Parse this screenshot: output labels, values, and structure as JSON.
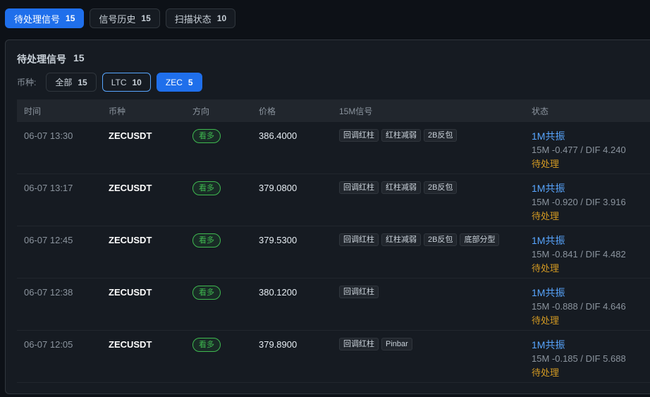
{
  "tabs": [
    {
      "label": "待处理信号",
      "count": "15"
    },
    {
      "label": "信号历史",
      "count": "15"
    },
    {
      "label": "扫描状态",
      "count": "10"
    }
  ],
  "panel": {
    "title": "待处理信号",
    "count": "15"
  },
  "filter": {
    "label": "币种:",
    "chips": [
      {
        "label": "全部",
        "count": "15"
      },
      {
        "label": "LTC",
        "count": "10"
      },
      {
        "label": "ZEC",
        "count": "5"
      }
    ]
  },
  "table": {
    "headers": {
      "time": "时间",
      "coin": "币种",
      "direction": "方向",
      "price": "价格",
      "signal": "15M信号",
      "status": "状态"
    },
    "rows": [
      {
        "time": "06-07 13:30",
        "coin": "ZECUSDT",
        "direction": "看多",
        "price": "386.4000",
        "tags": [
          "回调红柱",
          "红柱减弱",
          "2B反包"
        ],
        "resonance": "1M共振",
        "metrics": "15M -0.477 / DIF 4.240",
        "state": "待处理"
      },
      {
        "time": "06-07 13:17",
        "coin": "ZECUSDT",
        "direction": "看多",
        "price": "379.0800",
        "tags": [
          "回调红柱",
          "红柱减弱",
          "2B反包"
        ],
        "resonance": "1M共振",
        "metrics": "15M -0.920 / DIF 3.916",
        "state": "待处理"
      },
      {
        "time": "06-07 12:45",
        "coin": "ZECUSDT",
        "direction": "看多",
        "price": "379.5300",
        "tags": [
          "回调红柱",
          "红柱减弱",
          "2B反包",
          "底部分型"
        ],
        "resonance": "1M共振",
        "metrics": "15M -0.841 / DIF 4.482",
        "state": "待处理"
      },
      {
        "time": "06-07 12:38",
        "coin": "ZECUSDT",
        "direction": "看多",
        "price": "380.1200",
        "tags": [
          "回调红柱"
        ],
        "resonance": "1M共振",
        "metrics": "15M -0.888 / DIF 4.646",
        "state": "待处理"
      },
      {
        "time": "06-07 12:05",
        "coin": "ZECUSDT",
        "direction": "看多",
        "price": "379.8900",
        "tags": [
          "回调红柱",
          "Pinbar"
        ],
        "resonance": "1M共振",
        "metrics": "15M -0.185 / DIF 5.688",
        "state": "待处理"
      }
    ]
  }
}
